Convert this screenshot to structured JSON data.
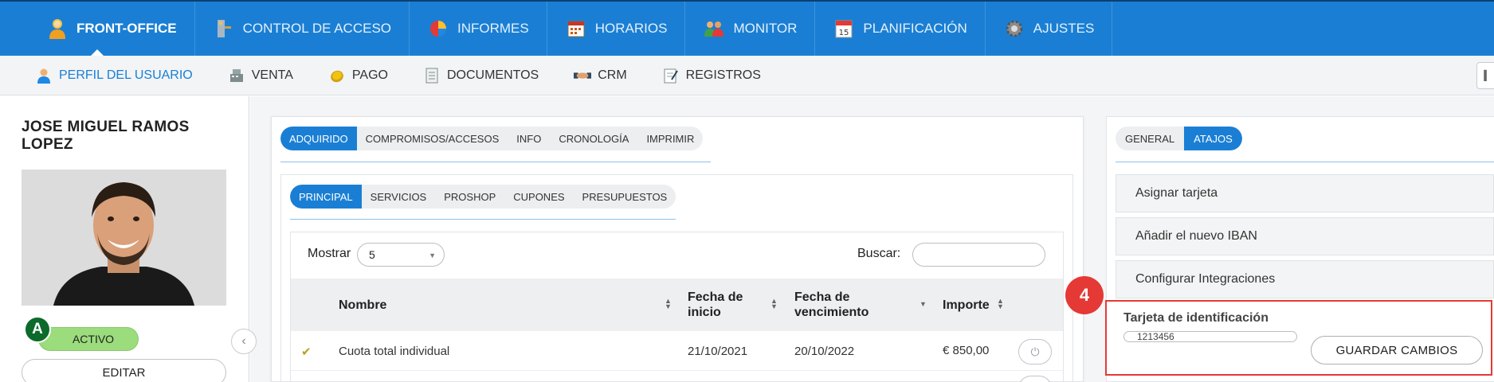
{
  "top_nav": [
    {
      "label": "FRONT-OFFICE",
      "icon": "user-icon",
      "active": true
    },
    {
      "label": "CONTROL DE ACCESO",
      "icon": "turnstile-icon",
      "active": false
    },
    {
      "label": "INFORMES",
      "icon": "pie-chart-icon",
      "active": false
    },
    {
      "label": "HORARIOS",
      "icon": "calendar-icon",
      "active": false
    },
    {
      "label": "MONITOR",
      "icon": "people-icon",
      "active": false
    },
    {
      "label": "PLANIFICACIÓN",
      "icon": "calendar-date-icon",
      "active": false
    },
    {
      "label": "AJUSTES",
      "icon": "gear-icon",
      "active": false
    }
  ],
  "sub_nav": [
    {
      "label": "PERFIL DEL USUARIO",
      "icon": "user-icon",
      "active": true
    },
    {
      "label": "VENTA",
      "icon": "cash-register-icon",
      "active": false
    },
    {
      "label": "PAGO",
      "icon": "coin-icon",
      "active": false
    },
    {
      "label": "DOCUMENTOS",
      "icon": "document-icon",
      "active": false
    },
    {
      "label": "CRM",
      "icon": "handshake-icon",
      "active": false
    },
    {
      "label": "REGISTROS",
      "icon": "notepad-icon",
      "active": false
    }
  ],
  "profile": {
    "name": "JOSE MIGUEL RAMOS LOPEZ",
    "badge": "A",
    "status": "ACTIVO",
    "edit_label": "EDITAR"
  },
  "main_tabs": [
    "ADQUIRIDO",
    "COMPROMISOS/ACCESOS",
    "INFO",
    "CRONOLOGÍA",
    "IMPRIMIR"
  ],
  "sub_tabs": [
    "PRINCIPAL",
    "SERVICIOS",
    "PROSHOP",
    "CUPONES",
    "PRESUPUESTOS"
  ],
  "table": {
    "show_label": "Mostrar",
    "show_value": "5",
    "search_label": "Buscar:",
    "search_value": "",
    "columns": [
      "Nombre",
      "Fecha de inicio",
      "Fecha de vencimiento",
      "Importe"
    ],
    "rows": [
      {
        "name": "Cuota total individual",
        "start": "21/10/2021",
        "end": "20/10/2022",
        "amount": "€ 850,00"
      }
    ]
  },
  "right_tabs": [
    "GENERAL",
    "ATAJOS"
  ],
  "shortcuts": [
    "Asignar tarjeta",
    "Añadir el nuevo IBAN",
    "Configurar Integraciones"
  ],
  "id_card": {
    "label": "Tarjeta de identificación",
    "value": "1213456",
    "save_label": "GUARDAR CAMBIOS"
  },
  "annotation_marker": "4",
  "colors": {
    "primary": "#1a7fd4",
    "highlight": "#e53935",
    "active_status": "#9bdc7c",
    "badge": "#0c6a2a"
  }
}
